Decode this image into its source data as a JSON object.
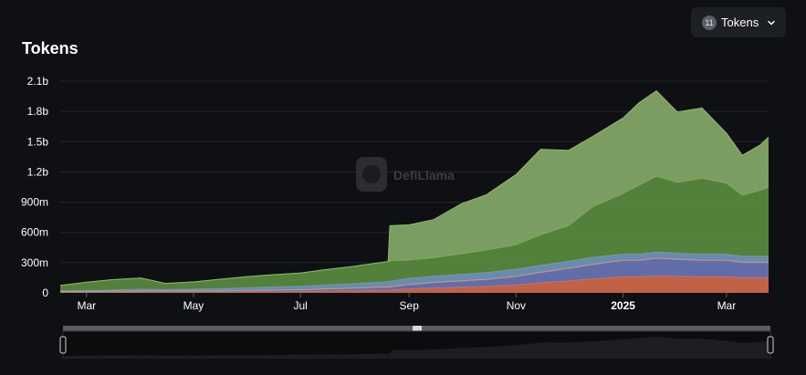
{
  "header": {
    "title": "Tokens",
    "select_label": "Tokens",
    "select_count": "11"
  },
  "watermark": {
    "text": "DefiLlama"
  },
  "colors": {
    "background": "#0e1013",
    "grid": "#24272c",
    "text": "#ffffff"
  },
  "chart_data": {
    "type": "area",
    "stacked": true,
    "title": "Tokens",
    "xlabel": "",
    "ylabel": "",
    "ylim": [
      0,
      2100000000
    ],
    "y_ticks": [
      {
        "label": "0",
        "value": 0
      },
      {
        "label": "300m",
        "value": 300000000
      },
      {
        "label": "600m",
        "value": 600000000
      },
      {
        "label": "900m",
        "value": 900000000
      },
      {
        "label": "1.2b",
        "value": 1200000000
      },
      {
        "label": "1.5b",
        "value": 1500000000
      },
      {
        "label": "1.8b",
        "value": 1800000000
      },
      {
        "label": "2.1b",
        "value": 2100000000
      }
    ],
    "xlim": [
      "2024-02-15",
      "2025-03-25"
    ],
    "x_ticks": [
      {
        "label": "Mar",
        "date": "2024-03-01",
        "bold": false
      },
      {
        "label": "May",
        "date": "2024-05-01",
        "bold": false
      },
      {
        "label": "Jul",
        "date": "2024-07-01",
        "bold": false
      },
      {
        "label": "Sep",
        "date": "2024-09-01",
        "bold": false
      },
      {
        "label": "Nov",
        "date": "2024-11-01",
        "bold": false
      },
      {
        "label": "2025",
        "date": "2025-01-01",
        "bold": true
      },
      {
        "label": "Mar",
        "date": "2025-03-01",
        "bold": false
      }
    ],
    "x": [
      "2024-02-15",
      "2024-03-01",
      "2024-03-15",
      "2024-04-01",
      "2024-04-15",
      "2024-05-01",
      "2024-05-15",
      "2024-06-01",
      "2024-06-15",
      "2024-07-01",
      "2024-07-15",
      "2024-08-01",
      "2024-08-20",
      "2024-08-21",
      "2024-09-01",
      "2024-09-15",
      "2024-10-01",
      "2024-10-15",
      "2024-11-01",
      "2024-11-15",
      "2024-12-01",
      "2024-12-15",
      "2025-01-01",
      "2025-01-10",
      "2025-01-20",
      "2025-02-01",
      "2025-02-15",
      "2025-03-01",
      "2025-03-10",
      "2025-03-20",
      "2025-03-25"
    ],
    "series": [
      {
        "color": "#e07050",
        "values": [
          5,
          5,
          6,
          8,
          8,
          9,
          9,
          10,
          12,
          14,
          18,
          22,
          28,
          28,
          40,
          50,
          58,
          65,
          80,
          100,
          120,
          140,
          160,
          160,
          170,
          165,
          160,
          160,
          150,
          150,
          150
        ]
      },
      {
        "color": "#6f7ec4",
        "values": [
          5,
          5,
          6,
          8,
          8,
          9,
          9,
          10,
          12,
          14,
          18,
          22,
          28,
          28,
          40,
          50,
          58,
          65,
          80,
          100,
          120,
          140,
          160,
          160,
          170,
          165,
          160,
          160,
          150,
          150,
          150
        ]
      },
      {
        "color": "#c9548f",
        "values": [
          2,
          2,
          2,
          2,
          2,
          2,
          2,
          2,
          2,
          2,
          2,
          2,
          2,
          2,
          2,
          2,
          2,
          2,
          2,
          2,
          2,
          2,
          2,
          2,
          2,
          2,
          2,
          2,
          2,
          2,
          2
        ]
      },
      {
        "color": "#d8a84a",
        "values": [
          1,
          1,
          1,
          1,
          1,
          1,
          1,
          2,
          2,
          2,
          2,
          3,
          3,
          3,
          3,
          3,
          3,
          3,
          3,
          3,
          3,
          3,
          3,
          3,
          3,
          3,
          3,
          3,
          3,
          3,
          3
        ]
      },
      {
        "color": "#7aa0cc",
        "values": [
          10,
          12,
          15,
          18,
          15,
          18,
          22,
          28,
          32,
          35,
          40,
          45,
          50,
          55,
          60,
          62,
          65,
          68,
          70,
          70,
          70,
          70,
          60,
          60,
          60,
          60,
          60,
          60,
          60,
          60,
          60
        ]
      },
      {
        "color": "#5f9442",
        "values": [
          50,
          80,
          100,
          110,
          60,
          70,
          90,
          110,
          120,
          130,
          150,
          170,
          200,
          200,
          180,
          180,
          200,
          220,
          240,
          300,
          350,
          500,
          600,
          680,
          750,
          700,
          750,
          700,
          600,
          650,
          680
        ]
      },
      {
        "color": "#8fb670",
        "values": [
          0,
          0,
          0,
          0,
          0,
          0,
          0,
          0,
          0,
          0,
          0,
          0,
          0,
          350,
          350,
          380,
          500,
          550,
          700,
          850,
          750,
          700,
          750,
          820,
          850,
          700,
          700,
          500,
          400,
          450,
          500
        ]
      }
    ]
  }
}
